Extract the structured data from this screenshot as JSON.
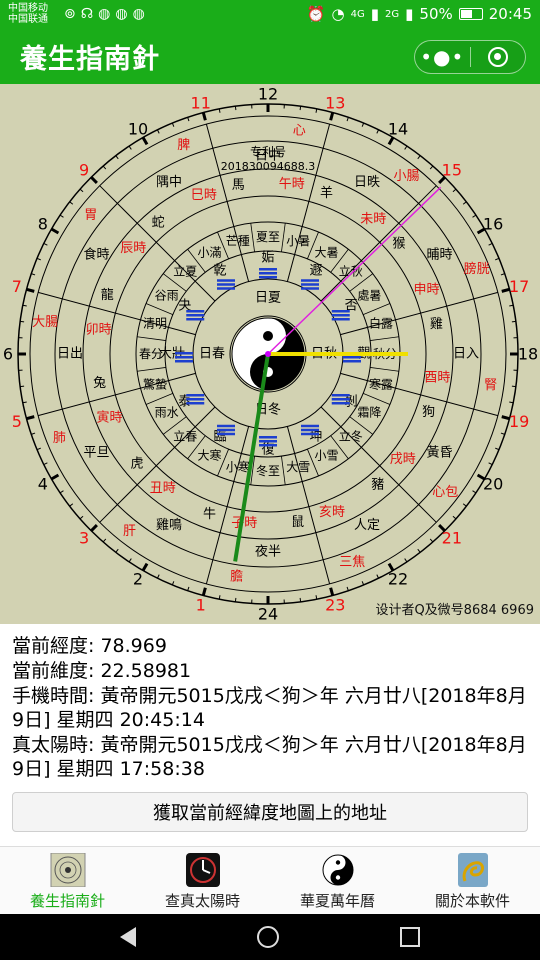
{
  "status_bar": {
    "carrier1": "中国移动",
    "carrier2": "中国联通",
    "battery": "50%",
    "time": "20:45",
    "net1": "4G",
    "net2": "2G"
  },
  "header": {
    "title": "養生指南針",
    "more_icon": "more-dots-icon",
    "close_icon": "target-circle-icon"
  },
  "compass": {
    "outer_hours": [
      "24",
      "1",
      "2",
      "3",
      "4",
      "5",
      "6",
      "7",
      "8",
      "9",
      "10",
      "11",
      "12",
      "13",
      "14",
      "15",
      "16",
      "17",
      "18",
      "19",
      "20",
      "21",
      "22",
      "23"
    ],
    "outer_hour_colors": [
      "#000",
      "#e11",
      "#000",
      "#e11",
      "#000",
      "#e11",
      "#000",
      "#e11",
      "#000",
      "#e11",
      "#000",
      "#e11",
      "#000",
      "#e11",
      "#000",
      "#e11",
      "#000",
      "#e11",
      "#000",
      "#e11",
      "#000",
      "#e11",
      "#000",
      "#e11"
    ],
    "shichen": [
      "子時",
      "丑時",
      "寅時",
      "卯時",
      "辰時",
      "巳時",
      "午時",
      "未時",
      "申時",
      "酉時",
      "戌時",
      "亥時"
    ],
    "animals": [
      "鼠",
      "牛",
      "虎",
      "兔",
      "龍",
      "蛇",
      "馬",
      "羊",
      "猴",
      "雞",
      "狗",
      "豬"
    ],
    "times": [
      "夜半",
      "雞鳴",
      "平旦",
      "日出",
      "食時",
      "隅中",
      "日中",
      "日昳",
      "晡時",
      "日入",
      "黃昏",
      "人定"
    ],
    "solar_terms": [
      "冬至",
      "小寒",
      "大寒",
      "立春",
      "雨水",
      "驚蟄",
      "春分",
      "清明",
      "谷雨",
      "立夏",
      "小滿",
      "芒種",
      "夏至",
      "小暑",
      "大暑",
      "立秋",
      "處暑",
      "白露",
      "秋分",
      "寒露",
      "霜降",
      "立冬",
      "小雪",
      "大雪"
    ],
    "meridians": [
      "膽",
      "肝",
      "肺",
      "大腸",
      "胃",
      "脾",
      "心",
      "小腸",
      "膀胱",
      "腎",
      "心包",
      "三焦"
    ],
    "hexagrams": [
      "復",
      "臨",
      "泰",
      "大壯",
      "夬",
      "乾",
      "姤",
      "遯",
      "否",
      "觀",
      "剝",
      "坤"
    ],
    "inner_labels": [
      "日冬",
      "日春",
      "日夏",
      "日秋"
    ],
    "patent_label": "专利号",
    "patent_number": "201830094688.3",
    "designer": "设计者Q及微号8684 6969"
  },
  "info": {
    "lng_label": "當前經度:",
    "lng": "78.969",
    "lat_label": "當前維度:",
    "lat": "22.58981",
    "phone_time_label": "手機時間:",
    "phone_time": "黃帝開元5015戊戌＜狗＞年 六月廿八[2018年8月9日] 星期四 20:45:14",
    "solar_time_label": "真太陽時:",
    "solar_time": "黃帝開元5015戊戌＜狗＞年 六月廿八[2018年8月9日] 星期四 17:58:38"
  },
  "button": {
    "label": "獲取當前經緯度地圖上的地址"
  },
  "tabs": [
    {
      "label": "養生指南針",
      "active": true,
      "icon": "compass-thumb-icon"
    },
    {
      "label": "查真太陽時",
      "active": false,
      "icon": "sundial-icon"
    },
    {
      "label": "華夏萬年曆",
      "active": false,
      "icon": "yin-yang-icon"
    },
    {
      "label": "關於本軟件",
      "active": false,
      "icon": "dragon-icon"
    }
  ],
  "colors": {
    "accent": "#1aad19",
    "compass_bg": "#d2d2b2",
    "red": "#e11111"
  }
}
